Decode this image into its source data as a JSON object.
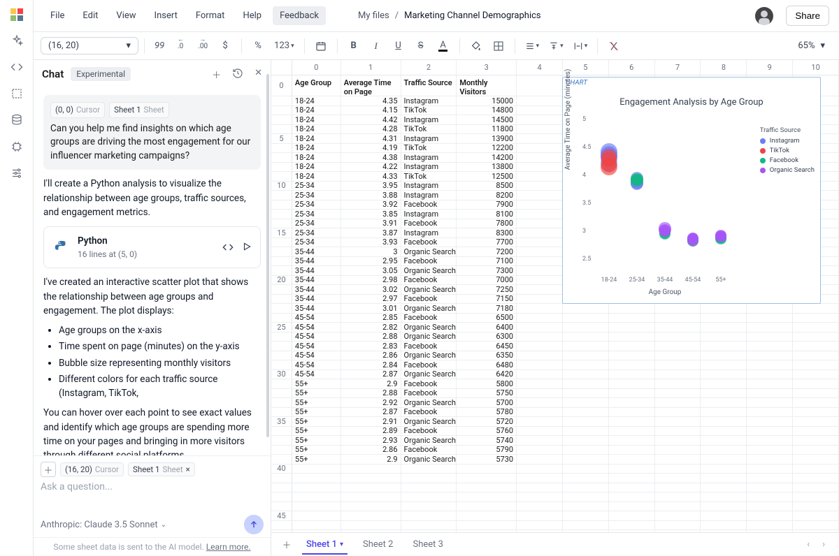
{
  "menu": {
    "file": "File",
    "edit": "Edit",
    "view": "View",
    "insert": "Insert",
    "format": "Format",
    "help": "Help",
    "feedback": "Feedback"
  },
  "breadcrumb": {
    "root": "My files",
    "sep": "/",
    "current": "Marketing Channel Demographics"
  },
  "share_label": "Share",
  "cell_ref": "(16, 20)",
  "zoom": "65%",
  "toolbar": {
    "num99": "99",
    "dec_dec": ".0",
    "inc_dec": ".00",
    "currency": "$",
    "percent": "%",
    "num123": "123",
    "bold": "B",
    "italic": "I",
    "underline": "U",
    "strike": "S",
    "textcolor": "A"
  },
  "chat": {
    "title": "Chat",
    "badge": "Experimental",
    "ctx_cell": "(0, 0)",
    "ctx_cursor": "Cursor",
    "ctx_sheet1": "Sheet 1",
    "ctx_sheet": "Sheet",
    "user_q": "Can you help me find insights on which age groups are driving the most engagement for our influencer marketing campaigns?",
    "assist_p1": "I'll create a Python analysis to visualize the relationship between age groups, traffic sources, and engagement metrics.",
    "code_title": "Python",
    "code_sub": "16 lines at (5, 0)",
    "assist_p2": "I've created an interactive scatter plot that shows the relationship between age groups and engagement. The plot displays:",
    "bullets": [
      "Age groups on the x-axis",
      "Time spent on page (minutes) on the y-axis",
      "Bubble size representing monthly visitors",
      "Different colors for each traffic source (Instagram, TikTok,"
    ],
    "assist_p3": "You can hover over each point to see exact values and identify which age groups are spending more time on your pages and bringing in more visitors through different social platforms.",
    "composer_cell": "(16, 20)",
    "composer_cursor": "Cursor",
    "composer_sheet1": "Sheet 1",
    "composer_sheet": "Sheet",
    "composer_x": "×",
    "placeholder": "Ask a question...",
    "model": "Anthropic: Claude 3.5 Sonnet",
    "footnote_a": "Some sheet data is sent to the AI model. ",
    "footnote_b": "Learn more."
  },
  "sheet": {
    "col_heads": [
      "0",
      "1",
      "2",
      "3",
      "4",
      "5",
      "6",
      "7",
      "8",
      "9",
      "10"
    ],
    "header_row": [
      "Age Group",
      "Average Time on Page (minutes)",
      "Traffic Source",
      "Monthly Visitors"
    ],
    "row_numbers": [
      "0",
      "5",
      "10",
      "15",
      "20",
      "25",
      "30",
      "35",
      "40",
      "45"
    ],
    "data": [
      [
        "18-24",
        "4.35",
        "Instagram",
        "15000"
      ],
      [
        "18-24",
        "4.15",
        "TikTok",
        "14800"
      ],
      [
        "18-24",
        "4.42",
        "Instagram",
        "14500"
      ],
      [
        "18-24",
        "4.28",
        "TikTok",
        "11800"
      ],
      [
        "18-24",
        "4.31",
        "Instagram",
        "13900"
      ],
      [
        "18-24",
        "4.19",
        "TikTok",
        "12200"
      ],
      [
        "18-24",
        "4.38",
        "Instagram",
        "14200"
      ],
      [
        "18-24",
        "4.22",
        "Instagram",
        "13800"
      ],
      [
        "18-24",
        "4.33",
        "TikTok",
        "12500"
      ],
      [
        "25-34",
        "3.95",
        "Instagram",
        "8500"
      ],
      [
        "25-34",
        "3.88",
        "Instagram",
        "8200"
      ],
      [
        "25-34",
        "3.92",
        "Facebook",
        "7900"
      ],
      [
        "25-34",
        "3.85",
        "Instagram",
        "8100"
      ],
      [
        "25-34",
        "3.91",
        "Facebook",
        "7800"
      ],
      [
        "25-34",
        "3.87",
        "Instagram",
        "8300"
      ],
      [
        "25-34",
        "3.93",
        "Facebook",
        "7700"
      ],
      [
        "35-44",
        "3",
        "Organic Search",
        "7200"
      ],
      [
        "35-44",
        "2.95",
        "Facebook",
        "7100"
      ],
      [
        "35-44",
        "3.05",
        "Organic Search",
        "7300"
      ],
      [
        "35-44",
        "2.98",
        "Facebook",
        "7000"
      ],
      [
        "35-44",
        "3.02",
        "Organic Search",
        "7250"
      ],
      [
        "35-44",
        "2.97",
        "Facebook",
        "7150"
      ],
      [
        "35-44",
        "3.01",
        "Organic Search",
        "7180"
      ],
      [
        "45-54",
        "2.85",
        "Facebook",
        "6500"
      ],
      [
        "45-54",
        "2.82",
        "Organic Search",
        "6400"
      ],
      [
        "45-54",
        "2.88",
        "Organic Search",
        "6300"
      ],
      [
        "45-54",
        "2.83",
        "Facebook",
        "6450"
      ],
      [
        "45-54",
        "2.86",
        "Organic Search",
        "6350"
      ],
      [
        "45-54",
        "2.84",
        "Facebook",
        "6480"
      ],
      [
        "45-54",
        "2.87",
        "Organic Search",
        "6420"
      ],
      [
        "55+",
        "2.9",
        "Facebook",
        "5800"
      ],
      [
        "55+",
        "2.88",
        "Facebook",
        "5750"
      ],
      [
        "55+",
        "2.92",
        "Organic Search",
        "5700"
      ],
      [
        "55+",
        "2.87",
        "Facebook",
        "5780"
      ],
      [
        "55+",
        "2.91",
        "Organic Search",
        "5720"
      ],
      [
        "55+",
        "2.89",
        "Facebook",
        "5760"
      ],
      [
        "55+",
        "2.93",
        "Organic Search",
        "5740"
      ],
      [
        "55+",
        "2.86",
        "Facebook",
        "5790"
      ],
      [
        "55+",
        "2.9",
        "Organic Search",
        "5730"
      ]
    ]
  },
  "chart": {
    "label": "CHART",
    "title": "Engagement Analysis by Age Group",
    "ylabel": "Average Time on Page (minutes)",
    "xlabel": "Age Group",
    "legend_title": "Traffic Source",
    "legend": [
      "Instagram",
      "TikTok",
      "Facebook",
      "Organic Search"
    ],
    "yticks": [
      "2.5",
      "3",
      "3.5",
      "4",
      "4.5",
      "5"
    ],
    "xticks": [
      "18-24",
      "25-34",
      "35-44",
      "45-54",
      "55+"
    ]
  },
  "tabs": {
    "s1": "Sheet 1",
    "s2": "Sheet 2",
    "s3": "Sheet 3"
  },
  "chart_data": {
    "type": "scatter",
    "title": "Engagement Analysis by Age Group",
    "xlabel": "Age Group",
    "ylabel": "Average Time on Page (minutes)",
    "x_categories": [
      "18-24",
      "25-34",
      "35-44",
      "45-54",
      "55+"
    ],
    "ylim": [
      2.5,
      5
    ],
    "size_field": "Monthly Visitors",
    "series": [
      {
        "name": "Instagram",
        "color": "#6d7cf4",
        "points": [
          {
            "x": "18-24",
            "y": 4.35,
            "size": 15000
          },
          {
            "x": "18-24",
            "y": 4.42,
            "size": 14500
          },
          {
            "x": "18-24",
            "y": 4.31,
            "size": 13900
          },
          {
            "x": "18-24",
            "y": 4.38,
            "size": 14200
          },
          {
            "x": "18-24",
            "y": 4.22,
            "size": 13800
          },
          {
            "x": "25-34",
            "y": 3.95,
            "size": 8500
          },
          {
            "x": "25-34",
            "y": 3.88,
            "size": 8200
          },
          {
            "x": "25-34",
            "y": 3.85,
            "size": 8100
          },
          {
            "x": "25-34",
            "y": 3.87,
            "size": 8300
          }
        ]
      },
      {
        "name": "TikTok",
        "color": "#ef4444",
        "points": [
          {
            "x": "18-24",
            "y": 4.15,
            "size": 14800
          },
          {
            "x": "18-24",
            "y": 4.28,
            "size": 11800
          },
          {
            "x": "18-24",
            "y": 4.19,
            "size": 12200
          },
          {
            "x": "18-24",
            "y": 4.33,
            "size": 12500
          }
        ]
      },
      {
        "name": "Facebook",
        "color": "#10b981",
        "points": [
          {
            "x": "25-34",
            "y": 3.92,
            "size": 7900
          },
          {
            "x": "25-34",
            "y": 3.91,
            "size": 7800
          },
          {
            "x": "25-34",
            "y": 3.93,
            "size": 7700
          },
          {
            "x": "35-44",
            "y": 2.95,
            "size": 7100
          },
          {
            "x": "35-44",
            "y": 2.98,
            "size": 7000
          },
          {
            "x": "35-44",
            "y": 2.97,
            "size": 7150
          },
          {
            "x": "45-54",
            "y": 2.85,
            "size": 6500
          },
          {
            "x": "45-54",
            "y": 2.83,
            "size": 6450
          },
          {
            "x": "45-54",
            "y": 2.84,
            "size": 6480
          },
          {
            "x": "55+",
            "y": 2.9,
            "size": 5800
          },
          {
            "x": "55+",
            "y": 2.88,
            "size": 5750
          },
          {
            "x": "55+",
            "y": 2.87,
            "size": 5780
          },
          {
            "x": "55+",
            "y": 2.89,
            "size": 5760
          },
          {
            "x": "55+",
            "y": 2.86,
            "size": 5790
          }
        ]
      },
      {
        "name": "Organic Search",
        "color": "#a855f7",
        "points": [
          {
            "x": "35-44",
            "y": 3.0,
            "size": 7200
          },
          {
            "x": "35-44",
            "y": 3.05,
            "size": 7300
          },
          {
            "x": "35-44",
            "y": 3.02,
            "size": 7250
          },
          {
            "x": "35-44",
            "y": 3.01,
            "size": 7180
          },
          {
            "x": "45-54",
            "y": 2.82,
            "size": 6400
          },
          {
            "x": "45-54",
            "y": 2.88,
            "size": 6300
          },
          {
            "x": "45-54",
            "y": 2.86,
            "size": 6350
          },
          {
            "x": "45-54",
            "y": 2.87,
            "size": 6420
          },
          {
            "x": "55+",
            "y": 2.92,
            "size": 5700
          },
          {
            "x": "55+",
            "y": 2.91,
            "size": 5720
          },
          {
            "x": "55+",
            "y": 2.93,
            "size": 5740
          },
          {
            "x": "55+",
            "y": 2.9,
            "size": 5730
          }
        ]
      }
    ]
  }
}
